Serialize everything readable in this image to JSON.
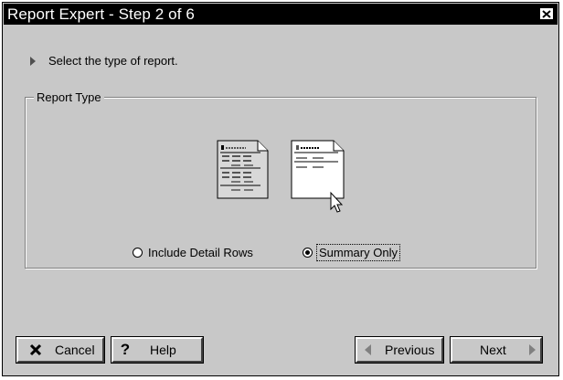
{
  "window": {
    "title": "Report Expert - Step 2 of 6"
  },
  "instruction": {
    "text": "Select the type of report."
  },
  "report_type": {
    "group_label": "Report Type",
    "options": [
      {
        "label": "Include Detail Rows",
        "selected": false
      },
      {
        "label": "Summary Only",
        "selected": true
      }
    ]
  },
  "buttons": {
    "cancel": "Cancel",
    "help": "Help",
    "previous": "Previous",
    "next": "Next"
  },
  "colors": {
    "dialog_bg": "#c8c8c8",
    "titlebar_bg": "#000000",
    "titlebar_text": "#ffffff"
  }
}
